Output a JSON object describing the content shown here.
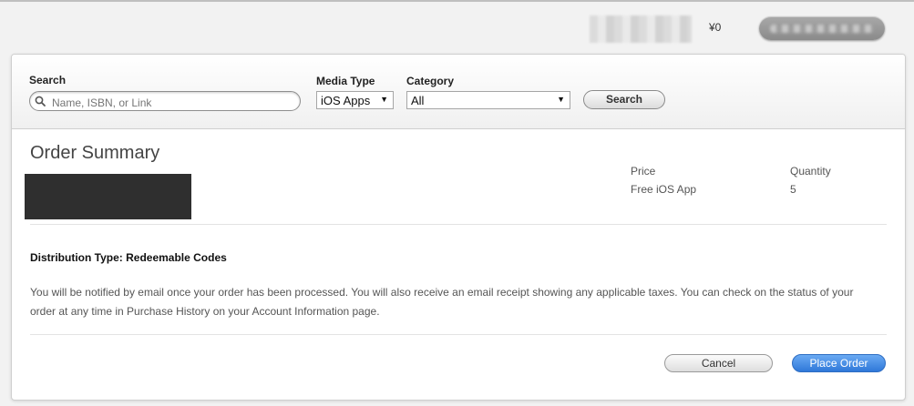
{
  "account": {
    "balance": "¥0"
  },
  "search": {
    "label": "Search",
    "placeholder": "Name, ISBN, or Link",
    "media_type_label": "Media Type",
    "media_type_value": "iOS Apps",
    "category_label": "Category",
    "category_value": "All",
    "button_label": "Search"
  },
  "order": {
    "title": "Order Summary",
    "price_header": "Price",
    "price_value": "Free iOS App",
    "quantity_header": "Quantity",
    "quantity_value": "5",
    "distribution": "Distribution Type: Redeemable Codes",
    "notice": "You will be notified by email once your order has been processed. You will also receive an email receipt showing any applicable taxes. You can check on the status of your order at any time in Purchase History on your Account Information page.",
    "cancel_label": "Cancel",
    "place_label": "Place Order"
  },
  "colors": {
    "primary_button": "#2f78d9",
    "artwork": "#2f2f2f"
  },
  "icons": {
    "search": "magnifier",
    "dropdown": "down-triangle"
  }
}
